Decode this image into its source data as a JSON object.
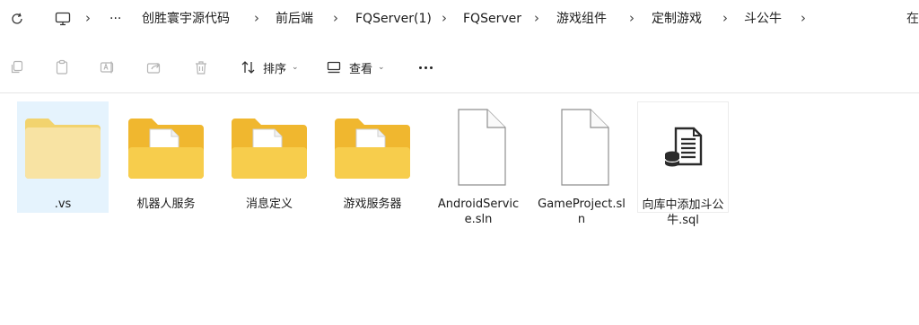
{
  "breadcrumb": {
    "overflow": "···",
    "segments": [
      "创胜寰宇源代码",
      "前后端",
      "FQServer(1)",
      "FQServer",
      "游戏组件",
      "定制游戏",
      "斗公牛"
    ],
    "separator": "›",
    "right_text": "在"
  },
  "toolbar": {
    "sort_label": "排序",
    "view_label": "查看"
  },
  "files": [
    {
      "name": ".vs",
      "type": "folder-empty",
      "selected": true
    },
    {
      "name": "机器人服务",
      "type": "folder-docs",
      "selected": false
    },
    {
      "name": "消息定义",
      "type": "folder-docs",
      "selected": false
    },
    {
      "name": "游戏服务器",
      "type": "folder-docs",
      "selected": false
    },
    {
      "name": "AndroidService.sln",
      "type": "file-generic",
      "selected": false
    },
    {
      "name": "GameProject.sln",
      "type": "file-generic",
      "selected": false
    },
    {
      "name": "向库中添加斗公牛.sql",
      "type": "file-sql",
      "selected": false
    }
  ],
  "colors": {
    "folder": "#F4C430",
    "folder_light": "#F8D775",
    "selection": "#E5F3FD"
  }
}
